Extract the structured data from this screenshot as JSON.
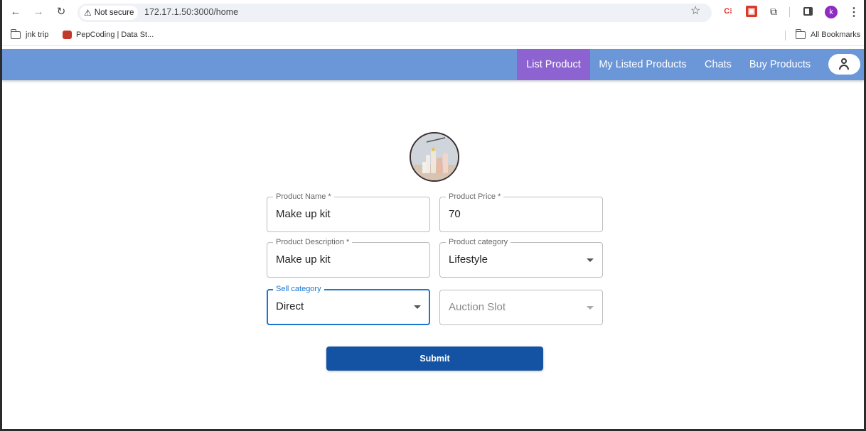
{
  "browser": {
    "security_label": "Not secure",
    "url": "172.17.1.50:3000/home",
    "profile_initial": "k",
    "extension_c_label": "C⁝",
    "bookmarks": [
      {
        "label": "jnk trip"
      },
      {
        "label": "PepCoding | Data St..."
      }
    ],
    "all_bookmarks_label": "All Bookmarks"
  },
  "header": {
    "tabs": [
      {
        "label": "List Product",
        "active": true
      },
      {
        "label": "My Listed Products"
      },
      {
        "label": "Chats"
      },
      {
        "label": "Buy Products"
      }
    ],
    "active_tab_color": "#8d63d2",
    "bar_color": "#6b97d8"
  },
  "form": {
    "product_name": {
      "label": "Product Name *",
      "value": "Make up kit"
    },
    "product_price": {
      "label": "Product Price *",
      "value": "70"
    },
    "product_description": {
      "label": "Product Description *",
      "value": "Make up kit"
    },
    "product_category": {
      "label": "Product category",
      "value": "Lifestyle"
    },
    "sell_category": {
      "label": "Sell category",
      "value": "Direct"
    },
    "auction_slot": {
      "placeholder": "Auction Slot"
    },
    "submit_label": "Submit",
    "submit_color": "#1452a3",
    "focus_color": "#1976d2"
  }
}
